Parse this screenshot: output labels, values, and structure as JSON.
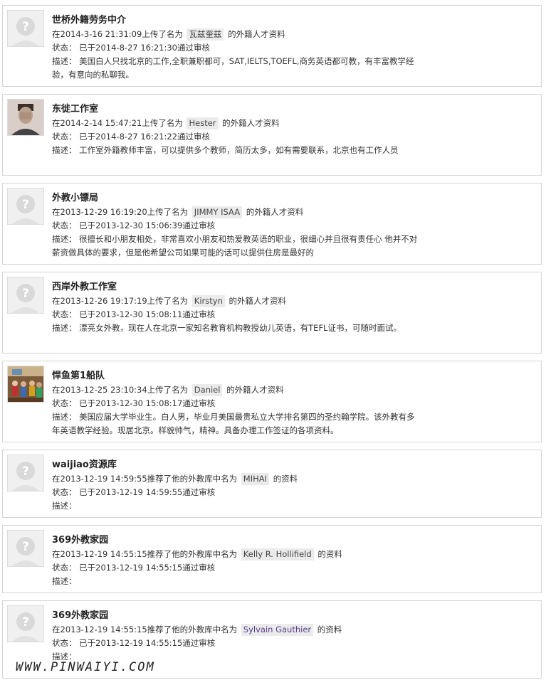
{
  "labels": {
    "status": "状态：",
    "desc": "描述：",
    "upload_prefix": "上传了名为",
    "upload_suffix": "的外籍人才资料",
    "rec_prefix": "推荐了他的外教库中名为",
    "rec_suffix": "的资料",
    "approved_prefix": "已于",
    "approved_suffix": "通过审核",
    "at": "在"
  },
  "entries": [
    {
      "org": "世桥外籍劳务中介",
      "time": "2014-3-16 21:31:09",
      "person": "瓦兹奎兹",
      "approved": "2014-8-27 16:21:30",
      "desc": "美国白人只找北京的工作,全职兼职都可，SAT,IELTS,TOEFL,商务英语都可教，有丰富教学经验，有意向的私聊我。",
      "avatar": "placeholder-avatar"
    },
    {
      "org": "东徙工作室",
      "time": "2014-2-14 15:47:21",
      "person": "Hester",
      "approved": "2014-8-27 16:21:22",
      "desc": "工作室外籍教师丰富，可以提供多个教师，简历太多，如有需要联系，北京也有工作人员",
      "avatar": "person-photo"
    },
    {
      "org": "外教小镖局",
      "time": "2013-12-29 16:19:20",
      "person": "JIMMY ISAA",
      "approved": "2013-12-30 15:06:39",
      "desc": "很擅长和小朋友相处，非常喜欢小朋友和热爱教英语的职业，很细心并且很有责任心 他并不对薪资做具体的要求，但是他希望公司如果可能的话可以提供住房是最好的",
      "avatar": "placeholder-avatar"
    },
    {
      "org": "西岸外教工作室",
      "time": "2013-12-26 19:17:19",
      "person": "Kirstyn",
      "approved": "2013-12-30 15:08:11",
      "desc": "漂亮女外教，现在人在北京一家知名教育机构教授幼儿英语，有TEFL证书，可随时面试。",
      "avatar": "placeholder-avatar"
    },
    {
      "org": "悍鱼第1船队",
      "time": "2013-12-25 23:10:34",
      "person": "Daniel",
      "approved": "2013-12-30 15:08:17",
      "desc": "美国应届大学毕业生。白人男，毕业月美国最贵私立大学排名第四的圣约翰学院。该外教有多年英语教学经验。现居北京。样貌帅气，精神。具备办理工作签证的各项资料。",
      "avatar": "group-photo"
    },
    {
      "org": "waijiao资源库",
      "time": "2013-12-19 14:59:55",
      "person": "MIHAI",
      "approved": "2013-12-19 14:59:55",
      "desc": "",
      "avatar": "placeholder-avatar",
      "recommend": true
    },
    {
      "org": "369外教家园",
      "time": "2013-12-19 14:55:15",
      "person": "Kelly R. Hollifield",
      "approved": "2013-12-19 14:55:15",
      "desc": "",
      "avatar": "placeholder-avatar",
      "recommend": true
    },
    {
      "org": "369外教家园",
      "time": "2013-12-19 14:55:15",
      "person": "Sylvain Gauthier",
      "approved": "2013-12-19 14:55:15",
      "desc": "",
      "avatar": "placeholder-avatar",
      "recommend": true,
      "link_color": "#553c8b"
    }
  ],
  "watermark": "WWW.PINWAIYI.COM"
}
